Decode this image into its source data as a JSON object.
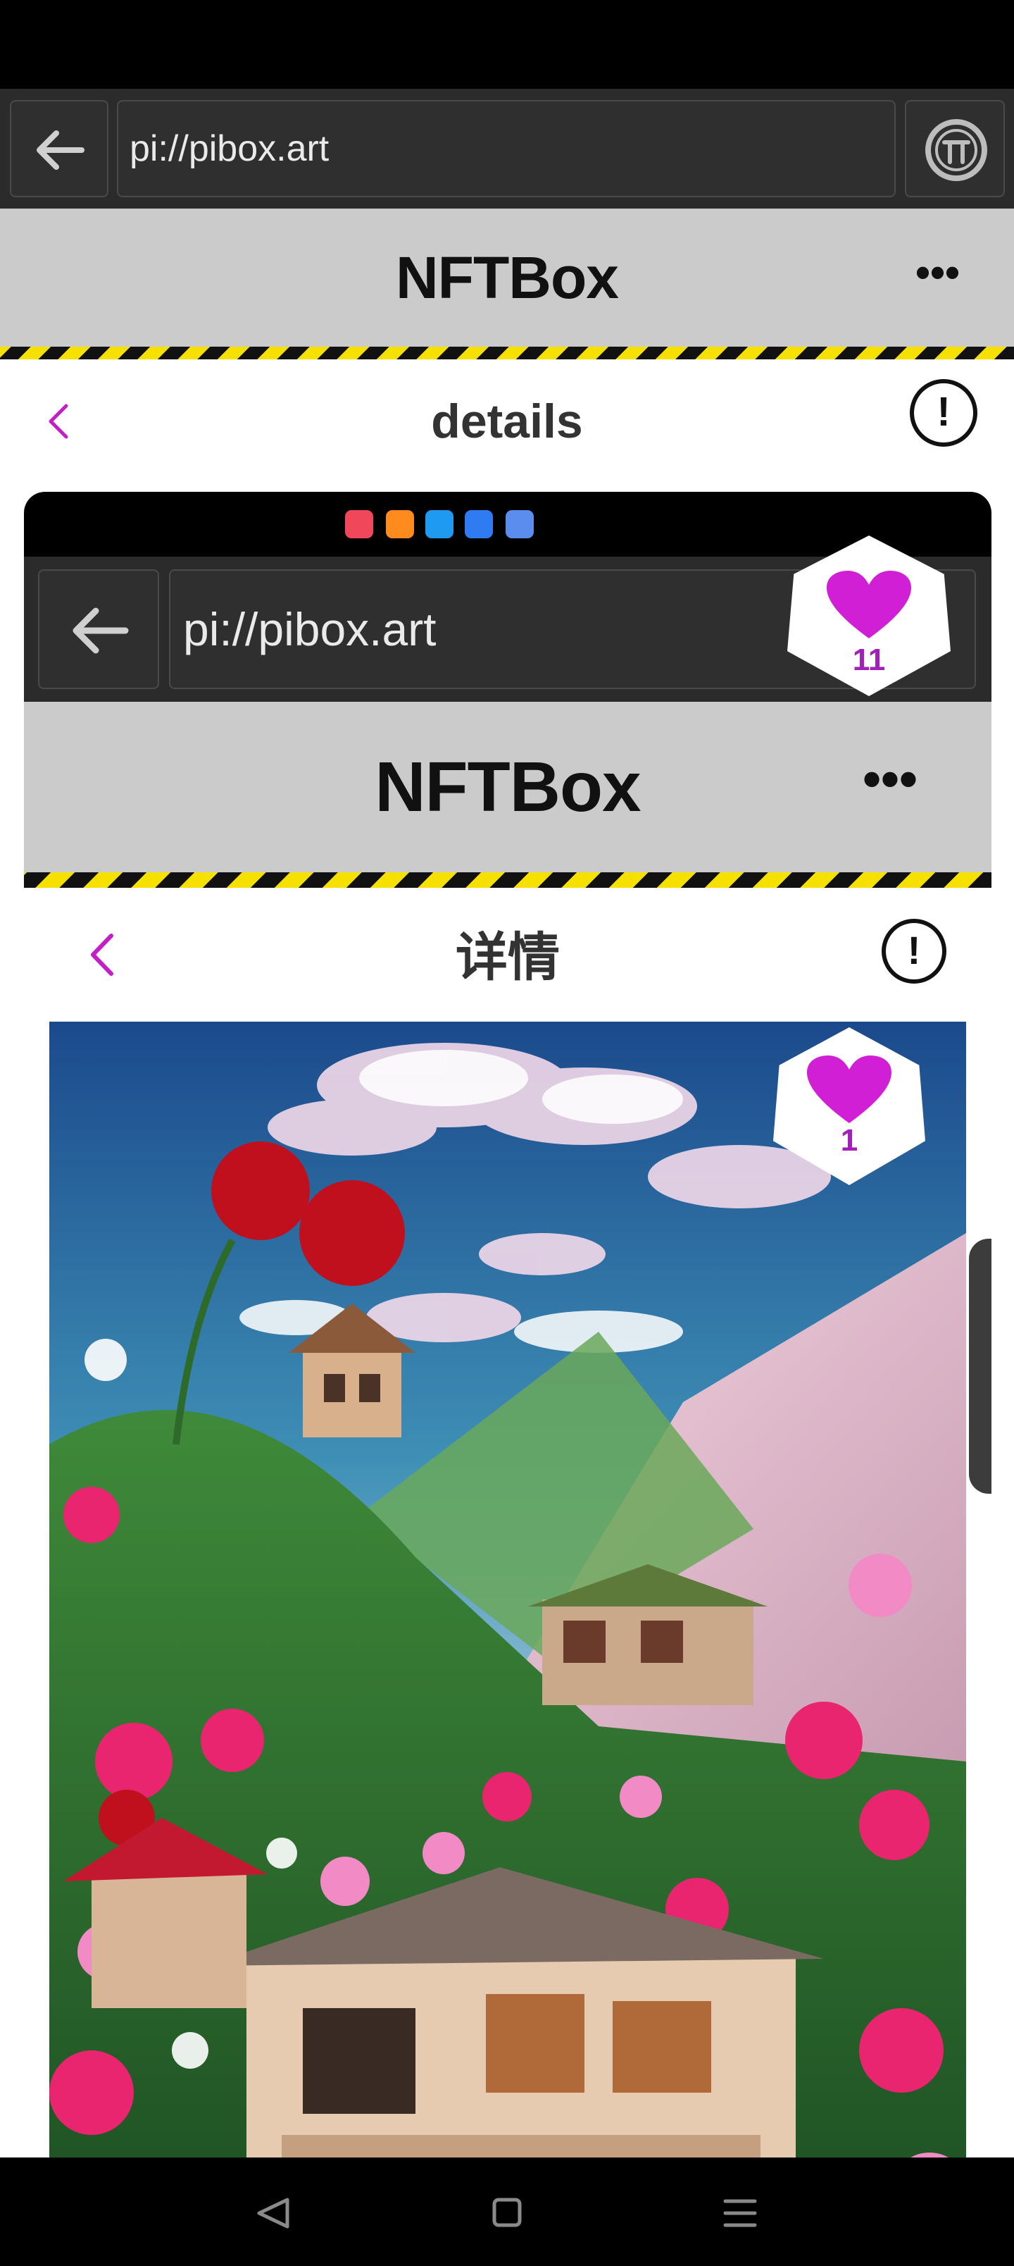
{
  "browser": {
    "url": "pi://pibox.art"
  },
  "app": {
    "title": "NFTBox",
    "menu": "•••"
  },
  "nav": {
    "title": "details",
    "info": "!"
  },
  "embedded": {
    "url": "pi://pibox.art",
    "title": "NFTBox",
    "menu": "•••",
    "nav_title": "详情",
    "info": "!"
  },
  "likes": {
    "total": "11",
    "item": "1"
  },
  "colors": {
    "accent": "#d11fd6",
    "hazard_yellow": "#f6e000",
    "header_gray": "#cbcbcb"
  },
  "icons": [
    "back-arrow-icon",
    "pi-logo-icon",
    "more-dots-icon",
    "chevron-left-icon",
    "info-icon",
    "heart-icon",
    "nav-back-icon",
    "nav-home-icon",
    "nav-menu-icon"
  ]
}
